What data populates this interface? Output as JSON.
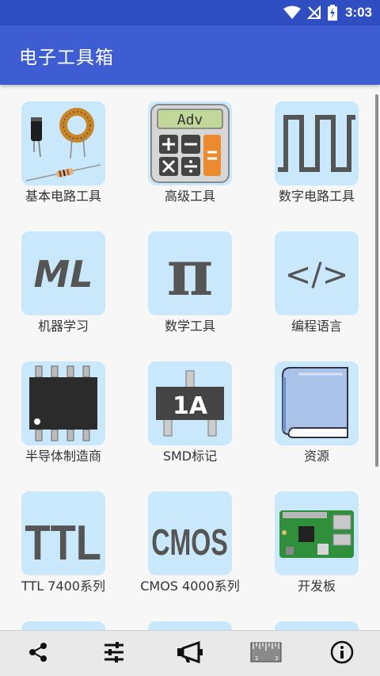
{
  "status_bar": {
    "time": "3:03"
  },
  "app_bar": {
    "title": "电子工具箱"
  },
  "icon_text": {
    "adv": "Adv",
    "ml": "ML",
    "pi": "π",
    "code": "</>",
    "chip_1a": "1A",
    "ttl": "TTL",
    "cmos": "CMOS"
  },
  "tiles": [
    {
      "label": "基本电路工具"
    },
    {
      "label": "高级工具"
    },
    {
      "label": "数字电路工具"
    },
    {
      "label": "机器学习"
    },
    {
      "label": "数学工具"
    },
    {
      "label": "编程语言"
    },
    {
      "label": "半导体制造商"
    },
    {
      "label": "SMD标记"
    },
    {
      "label": "资源"
    },
    {
      "label": "TTL 7400系列"
    },
    {
      "label": "CMOS 4000系列"
    },
    {
      "label": "开发板"
    }
  ],
  "bottom_nav": [
    "share-icon",
    "sliders-icon",
    "megaphone-icon",
    "ruler-icon",
    "info-icon"
  ],
  "colors": {
    "status_bar": "#2f4ec1",
    "app_bar": "#3f5dd3",
    "tile_bg": "#c9e8fb",
    "icon_gray": "#555555"
  }
}
